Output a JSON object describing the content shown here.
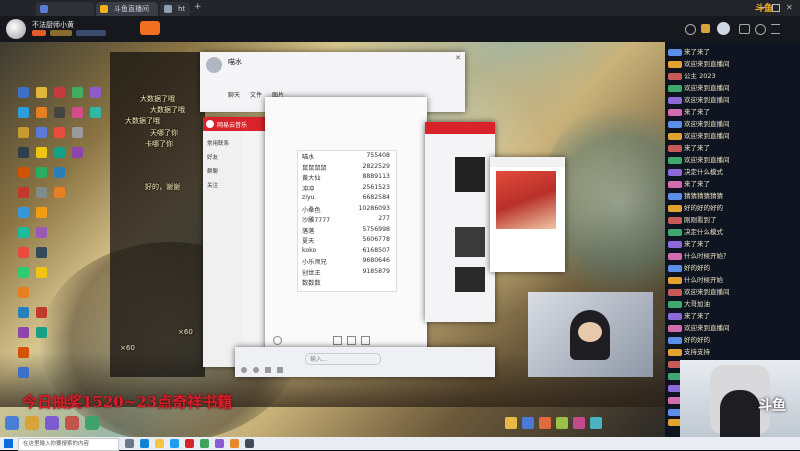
{
  "browser": {
    "tabs": [
      {
        "label": ""
      },
      {
        "label": "斗鱼直播间"
      },
      {
        "label": "ht"
      }
    ],
    "new_tab": "+"
  },
  "header": {
    "site_name": "斗鱼",
    "streamer_name": "不法厨师小黄"
  },
  "stream": {
    "overlay_text": "今日抽奖1520~23点奇祥书籍",
    "overlay_color": "#d61e2a",
    "qq_window": {
      "title": "喵水",
      "tabs": [
        "聊天",
        "文件",
        "图片"
      ],
      "friends": [
        "常用联系",
        "好友",
        "群聊",
        "关注"
      ],
      "table": [
        {
          "name": "喵水",
          "value": "755408"
        },
        {
          "name": "鼠鼠鼠鼠",
          "value": "2822529"
        },
        {
          "name": "黄大仙",
          "value": "8889113"
        },
        {
          "name": "冲冲",
          "value": "2561523"
        },
        {
          "name": "ziyu",
          "value": "6682584"
        },
        {
          "name": "小桑色",
          "value": "10286093"
        },
        {
          "name": "沙雕7777",
          "value": "277"
        },
        {
          "name": "落落",
          "value": "5756998"
        },
        {
          "name": "夏天",
          "value": "5606778"
        },
        {
          "name": "koko",
          "value": "6168507"
        },
        {
          "name": "小乐师兄",
          "value": "9680646"
        },
        {
          "name": "创世王",
          "value": "9185879"
        },
        {
          "name": "数数数",
          "value": ""
        }
      ],
      "input_placeholder": "输入..."
    },
    "netease_window": {
      "title": "网易云音乐"
    },
    "danmu": [
      "大数据了哦",
      "大数据了哦",
      "大数据了哦",
      "天哪了你",
      "卡哪了你",
      "好的，谢谢",
      "×60",
      "×60"
    ]
  },
  "chat": {
    "messages": [
      {
        "user": "",
        "text": "来了来了"
      },
      {
        "user": "",
        "text": "欢迎来到直播间"
      },
      {
        "user": "",
        "text": "公主 2023"
      },
      {
        "user": "",
        "text": "欢迎来到直播间"
      },
      {
        "user": "",
        "text": "欢迎来到直播间"
      },
      {
        "user": "",
        "text": "来了来了"
      },
      {
        "user": "",
        "text": "欢迎来到直播间"
      },
      {
        "user": "",
        "text": "欢迎来到直播间"
      },
      {
        "user": "",
        "text": "来了来了"
      },
      {
        "user": "",
        "text": "欢迎来到直播间"
      },
      {
        "user": "",
        "text": "决定什么模式"
      },
      {
        "user": "",
        "text": "来了来了"
      },
      {
        "user": "",
        "text": "猜猜猜猜猜猜"
      },
      {
        "user": "",
        "text": "好的好的好的"
      },
      {
        "user": "",
        "text": "刚刚看到了"
      },
      {
        "user": "",
        "text": "决定什么模式"
      },
      {
        "user": "",
        "text": "来了来了"
      },
      {
        "user": "",
        "text": "什么时候开始？"
      },
      {
        "user": "",
        "text": "好的好的"
      },
      {
        "user": "",
        "text": "什么时候开始"
      },
      {
        "user": "",
        "text": "欢迎来到直播间"
      },
      {
        "user": "",
        "text": "大哥加油"
      },
      {
        "user": "",
        "text": "来了来了"
      },
      {
        "user": "",
        "text": "欢迎来到直播间"
      },
      {
        "user": "",
        "text": "好的好的"
      },
      {
        "user": "",
        "text": "支持支持"
      },
      {
        "user": "",
        "text": "来了来了"
      },
      {
        "user": "",
        "text": "什么时候开始"
      },
      {
        "user": "",
        "text": "欢迎来到直播间"
      },
      {
        "user": "",
        "text": "支持支持"
      },
      {
        "user": "",
        "text": "来了来了"
      },
      {
        "user": "",
        "text": "×60"
      }
    ]
  },
  "webcam": {
    "caption": "斗鱼"
  },
  "taskbar": {
    "search_placeholder": "在这里输入你要搜索的内容"
  }
}
